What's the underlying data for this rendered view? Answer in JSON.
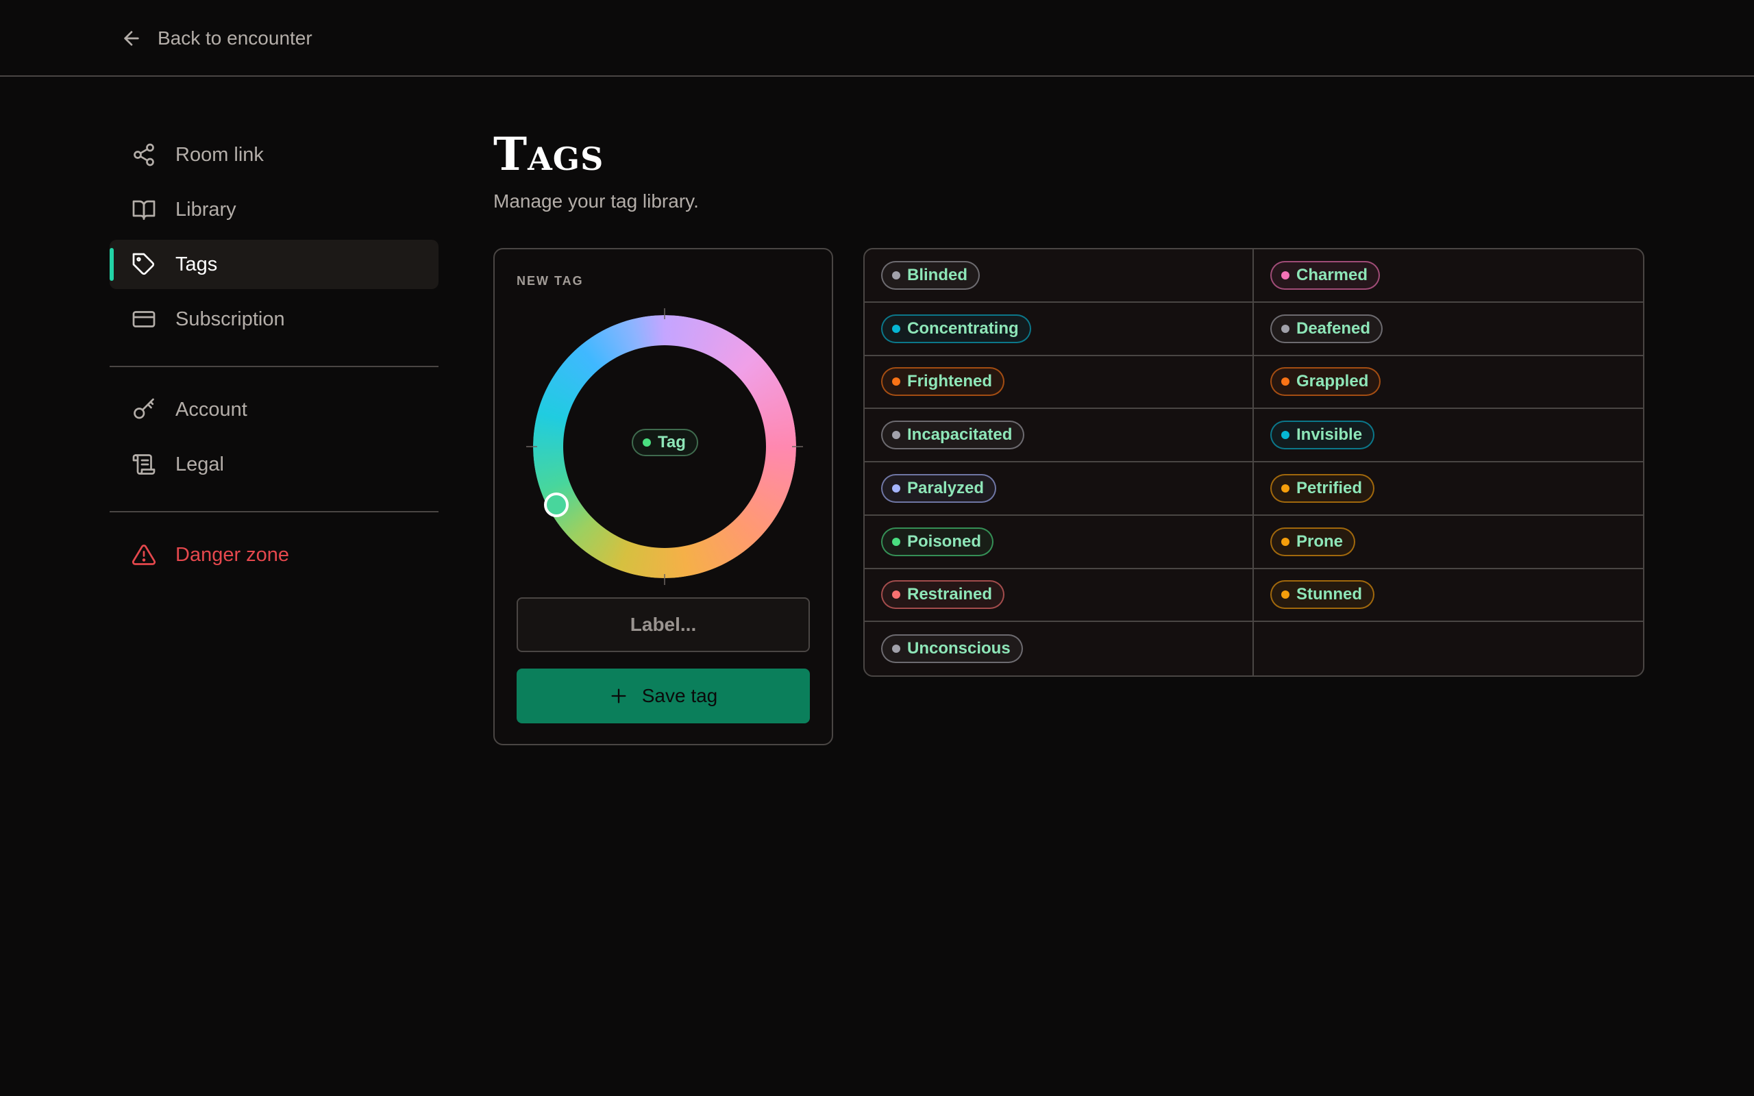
{
  "topbar": {
    "back_label": "Back to encounter"
  },
  "sidebar": {
    "items": [
      {
        "label": "Room link"
      },
      {
        "label": "Library"
      },
      {
        "label": "Tags"
      },
      {
        "label": "Subscription"
      },
      {
        "label": "Account"
      },
      {
        "label": "Legal"
      },
      {
        "label": "Danger zone"
      }
    ]
  },
  "main": {
    "title": "Tags",
    "subtitle": "Manage your tag library."
  },
  "new_tag": {
    "heading": "NEW TAG",
    "preview_label": "Tag",
    "preview_color": "#4ade80",
    "input_placeholder": "Label...",
    "save_label": "Save tag"
  },
  "tags": [
    {
      "label": "Blinded",
      "color": "#a1a1aa"
    },
    {
      "label": "Charmed",
      "color": "#f472b6"
    },
    {
      "label": "Concentrating",
      "color": "#06b6d4"
    },
    {
      "label": "Deafened",
      "color": "#a1a1aa"
    },
    {
      "label": "Frightened",
      "color": "#f97316"
    },
    {
      "label": "Grappled",
      "color": "#f97316"
    },
    {
      "label": "Incapacitated",
      "color": "#a1a1aa"
    },
    {
      "label": "Invisible",
      "color": "#06b6d4"
    },
    {
      "label": "Paralyzed",
      "color": "#a5b4fc"
    },
    {
      "label": "Petrified",
      "color": "#f59e0b"
    },
    {
      "label": "Poisoned",
      "color": "#4ade80"
    },
    {
      "label": "Prone",
      "color": "#f59e0b"
    },
    {
      "label": "Restrained",
      "color": "#f87171"
    },
    {
      "label": "Stunned",
      "color": "#f59e0b"
    },
    {
      "label": "Unconscious",
      "color": "#a1a1aa"
    }
  ]
}
